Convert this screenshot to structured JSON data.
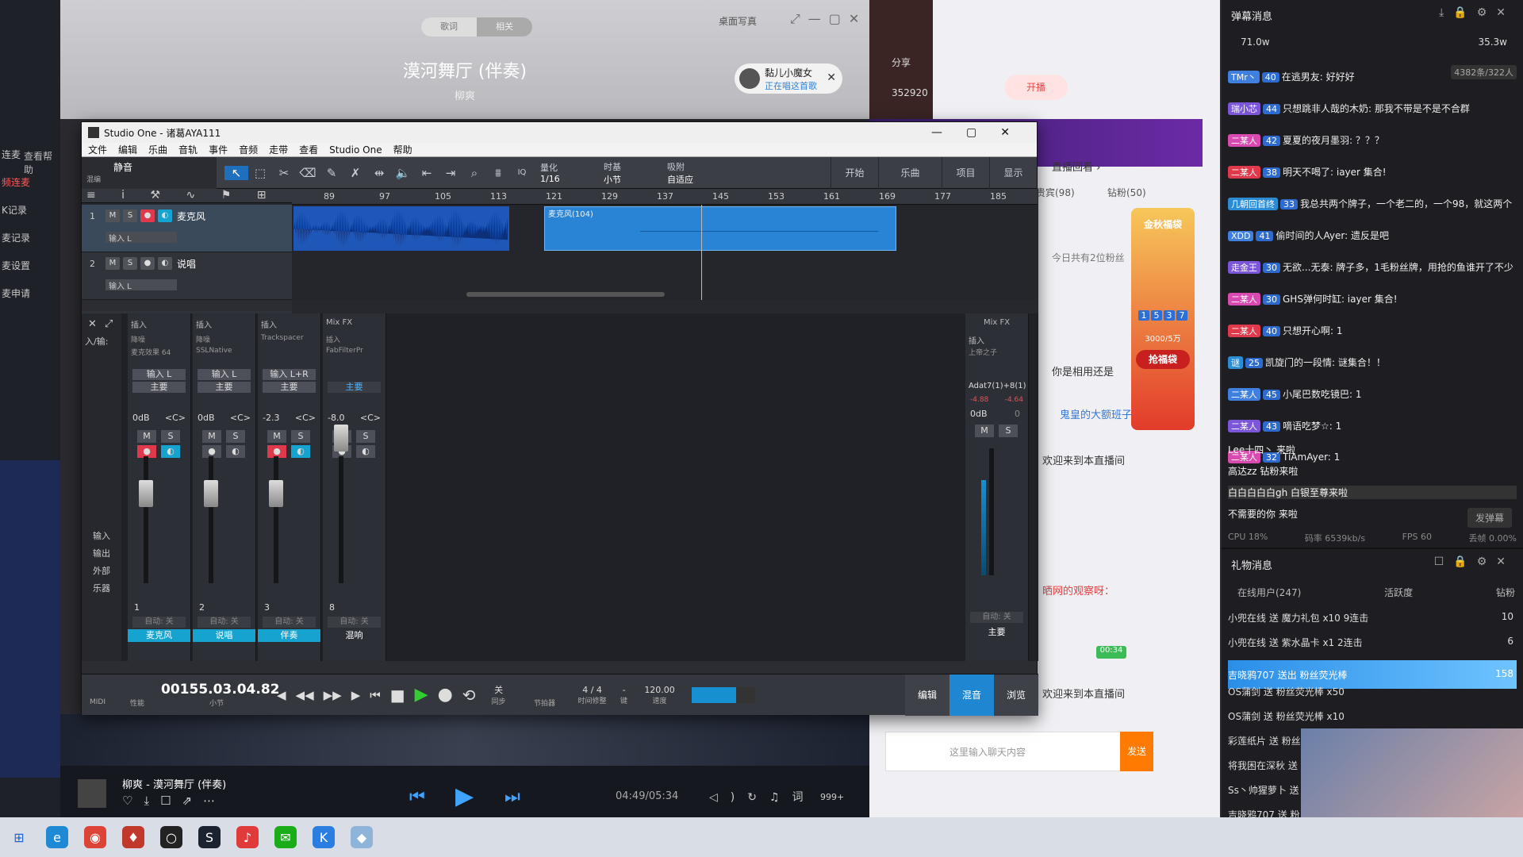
{
  "music_player": {
    "tab_lyrics": "歌词",
    "tab_related": "相关",
    "desktop_lyrics": "桌面写真",
    "song_title": "漠河舞厅 (伴奏)",
    "artist": "柳爽",
    "listener_name": "黏儿小魔女",
    "listener_status": "正在唱这首歌",
    "now_playing": "柳爽 - 漠河舞厅 (伴奏)",
    "time": "04:49/05:34",
    "count": "999+"
  },
  "left_panel": {
    "items": [
      "连麦",
      "频连麦",
      "K记录",
      "麦记录",
      "麦设置",
      "麦申请"
    ],
    "help": "查看帮助"
  },
  "browser": {
    "share": "分享",
    "likes": "352920",
    "open_live": "开播",
    "replay": "直播回看 ›",
    "tab_fans": "贵宾(98)",
    "tab_diamond": "钻粉(50)",
    "fans_today": "今日共有2位粉丝",
    "lottery_title": "金秋福袋",
    "lottery_progress": "3000/5万",
    "lottery_button": "抢福袋",
    "lottery_digits": [
      "1",
      "5",
      "3",
      "7"
    ],
    "chat_input_placeholder": "这里输入聊天内容",
    "send": "发送",
    "welcome": "欢迎来到本直播间",
    "timer": "00:34",
    "viewer_msg": "晒网的观察呀：",
    "ghost_user": "鬼皇的大额班子",
    "question": "你是相用还是"
  },
  "studio": {
    "title": "Studio One - 诸葛AYA111",
    "menu": [
      "文件",
      "编辑",
      "乐曲",
      "音轨",
      "事件",
      "音频",
      "走带",
      "查看",
      "Studio One",
      "帮助"
    ],
    "mode": "静音",
    "mode_sub": "混编",
    "quantize_label": "量化",
    "quantize_value": "1/16",
    "timebase_label": "时基",
    "timebase_value": "小节",
    "snap_label": "吸附",
    "snap_value": "自适应",
    "right_tabs": [
      "开始",
      "乐曲",
      "项目",
      "显示"
    ],
    "ruler": [
      "89",
      "97",
      "105",
      "113",
      "121",
      "129",
      "137",
      "145",
      "153",
      "161",
      "169",
      "177",
      "185"
    ],
    "tracks": [
      {
        "num": "1",
        "name": "麦克风",
        "input": "输入 L"
      },
      {
        "num": "2",
        "name": "说唱",
        "input": "输入 L"
      }
    ],
    "clip_label": "麦克风(104)",
    "channels": [
      {
        "insert": "插入",
        "fx1": "降噪",
        "fx2": "麦克效果 64",
        "input": "输入 L",
        "bus": "主要",
        "vol": "0dB",
        "pan": "<C>",
        "num": "1",
        "auto": "自动: 关",
        "name": "麦克风",
        "color": "#17a3cf"
      },
      {
        "insert": "插入",
        "fx1": "降噪",
        "fx2": "SSLNative",
        "input": "输入 L",
        "bus": "主要",
        "vol": "0dB",
        "pan": "<C>",
        "num": "2",
        "auto": "自动: 关",
        "name": "说唱",
        "color": "#17a3cf"
      },
      {
        "insert": "插入",
        "fx1": "Trackspacer",
        "fx2": "",
        "input": "输入 L+R",
        "bus": "主要",
        "vol": "-2.3",
        "pan": "<C>",
        "num": "3",
        "auto": "自动: 关",
        "name": "伴奏",
        "color": "#17a3cf"
      },
      {
        "insert": "Mix FX",
        "fx1": "插入",
        "fx2": "FabFilterPr",
        "input": "",
        "bus": "主要",
        "vol": "-8.0",
        "pan": "<C>",
        "num": "8",
        "auto": "自动: 关",
        "name": "混响",
        "color": "#2c2f35"
      }
    ],
    "main_channel": {
      "fx": "Mix FX",
      "insert": "插入",
      "plugin": "上帝之子",
      "input": "Adat7(1)+8(1)",
      "l": "-4.88",
      "r": "-4.64",
      "vol": "0dB",
      "zero": "0",
      "auto": "自动: 关",
      "name": "主要"
    },
    "side_labels": [
      "输入",
      "输出",
      "外部",
      "乐器"
    ],
    "routing": "入/输:",
    "transport": {
      "midi": "MIDI",
      "perf": "性能",
      "time": "00155.03.04.82",
      "time_unit": "小节",
      "sync_label": "关",
      "sync_sub": "同步",
      "metronome": "节拍器",
      "signature": "4 / 4",
      "sig_sub": "时间修整",
      "key": "-",
      "key_sub": "键",
      "tempo": "120.00",
      "tempo_sub": "速度"
    },
    "view_tabs": [
      "编辑",
      "混音",
      "浏览"
    ]
  },
  "danmu": {
    "title": "弹幕消息",
    "likes": "71.0w",
    "hearts": "35.3w",
    "online": "4382条/322人",
    "messages": [
      {
        "user": "TMr丶",
        "badge": "40",
        "text": "在逃男友: 好好好"
      },
      {
        "user": "瑞小芯",
        "badge": "44",
        "text": "只想跳非人哉的木奶: 那我不带是不是不合群"
      },
      {
        "user": "二某人",
        "badge": "42",
        "text": "夏夏的夜月墨羽: ？？？"
      },
      {
        "user": "二某人",
        "badge": "38",
        "text": "明天不喝了: iayer 集合!"
      },
      {
        "user": "几朝回首终",
        "badge": "33",
        "text": "我总共两个牌子，一个老二的，一个98，就这两个"
      },
      {
        "user": "XDD",
        "badge": "41",
        "text": "偷时间的人Ayer: 遗反是吧"
      },
      {
        "user": "走金王",
        "badge": "30",
        "text": "无欲...无泰: 牌子多，1毛粉丝牌，用抢的鱼谁开了不少"
      },
      {
        "user": "二某人",
        "badge": "30",
        "text": "GHS弹何时缸: iayer 集合!"
      },
      {
        "user": "二某人",
        "badge": "40",
        "text": "只想开心啊: 1"
      },
      {
        "user": "谜",
        "badge": "25",
        "text": "凯旋门的一段情: 谜集合！！"
      },
      {
        "user": "二某人",
        "badge": "45",
        "text": "小尾巴数吃镜巴: 1"
      },
      {
        "user": "二某人",
        "badge": "43",
        "text": "嘀语吃梦☆: 1"
      },
      {
        "user": "二某人",
        "badge": "32",
        "text": "TiAmAyer: 1"
      }
    ],
    "enters": [
      "Lee十四丶 来啦",
      "高达zz 钻粉来啦",
      "白白白白白gh 白银至尊来啦",
      "不需要的你 来啦"
    ],
    "send_danmu": "发弹幕",
    "stats": {
      "cpu": "CPU 18%",
      "rate": "码率 6539kb/s",
      "fps": "FPS 60",
      "drop": "丢帧 0.00%"
    },
    "gift_title": "礼物消息",
    "gift_cols": [
      "在线用户(247)",
      "活跃度",
      "钻粉"
    ],
    "gifts": [
      {
        "text": "小兜在线 送 魔力礼包 x10 9连击",
        "n": "10"
      },
      {
        "text": "小兜在线 送 紫水晶卡 x1 2连击",
        "n": "6"
      },
      {
        "text": "吉晓鸦707 送出 粉丝荧光棒",
        "n": "158"
      },
      {
        "text": "OS蒲剑 送 粉丝荧光棒 x50",
        "n": ""
      },
      {
        "text": "OS蒲剑 送 粉丝荧光棒 x10",
        "n": ""
      },
      {
        "text": "彩莲纸片 送 粉丝荧光棒",
        "n": ""
      },
      {
        "text": "将我困在深秋 送",
        "n": ""
      },
      {
        "text": "Ss丶帅猩萝卜 送",
        "n": ""
      },
      {
        "text": "吉晓鸦707 送 粉",
        "n": ""
      }
    ]
  },
  "colors": {
    "accent": "#17a3cf",
    "record": "#e0394c",
    "play": "#33cc33",
    "danmu_bg": "#1e1e22"
  }
}
